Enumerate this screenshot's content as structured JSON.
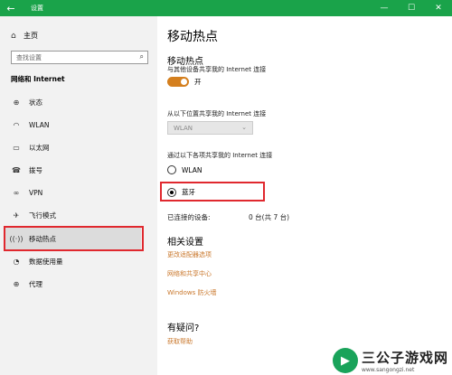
{
  "window": {
    "title": "设置"
  },
  "sidebar": {
    "home_label": "主页",
    "search_placeholder": "查找设置",
    "section_title": "网络和 Internet",
    "items": [
      {
        "label": "状态",
        "icon": "globe-icon"
      },
      {
        "label": "WLAN",
        "icon": "wifi-icon"
      },
      {
        "label": "以太网",
        "icon": "ethernet-icon"
      },
      {
        "label": "拨号",
        "icon": "phone-icon"
      },
      {
        "label": "VPN",
        "icon": "vpn-icon"
      },
      {
        "label": "飞行模式",
        "icon": "airplane-icon"
      },
      {
        "label": "移动热点",
        "icon": "hotspot-icon"
      },
      {
        "label": "数据使用量",
        "icon": "data-usage-icon"
      },
      {
        "label": "代理",
        "icon": "globe-icon"
      }
    ],
    "active_index": 6
  },
  "main": {
    "page_title": "移动热点",
    "hotspot": {
      "heading": "移动热点",
      "share_desc": "与其他设备共享我的 Internet 连接",
      "toggle_label": "开",
      "toggle_on": true
    },
    "share_from": {
      "label": "从以下位置共享我的 Internet 连接",
      "selected": "WLAN"
    },
    "share_over": {
      "label": "通过以下各项共享我的 Internet 连接",
      "options": [
        "WLAN",
        "蓝牙"
      ],
      "selected_index": 1
    },
    "devices": {
      "label": "已连接的设备:",
      "value": "0 台(共 7 台)"
    },
    "related": {
      "heading": "相关设置",
      "links": [
        "更改适配器选项",
        "网络和共享中心",
        "Windows 防火墙"
      ]
    },
    "help": {
      "heading": "有疑问?",
      "link": "获取帮助"
    }
  },
  "watermark": {
    "title": "三公子游戏网",
    "url": "www.sangongzi.net"
  },
  "colors": {
    "titlebar": "#1aa34a",
    "accent": "#d47f1e",
    "link": "#c9772b",
    "highlight_box": "#e0282e"
  }
}
